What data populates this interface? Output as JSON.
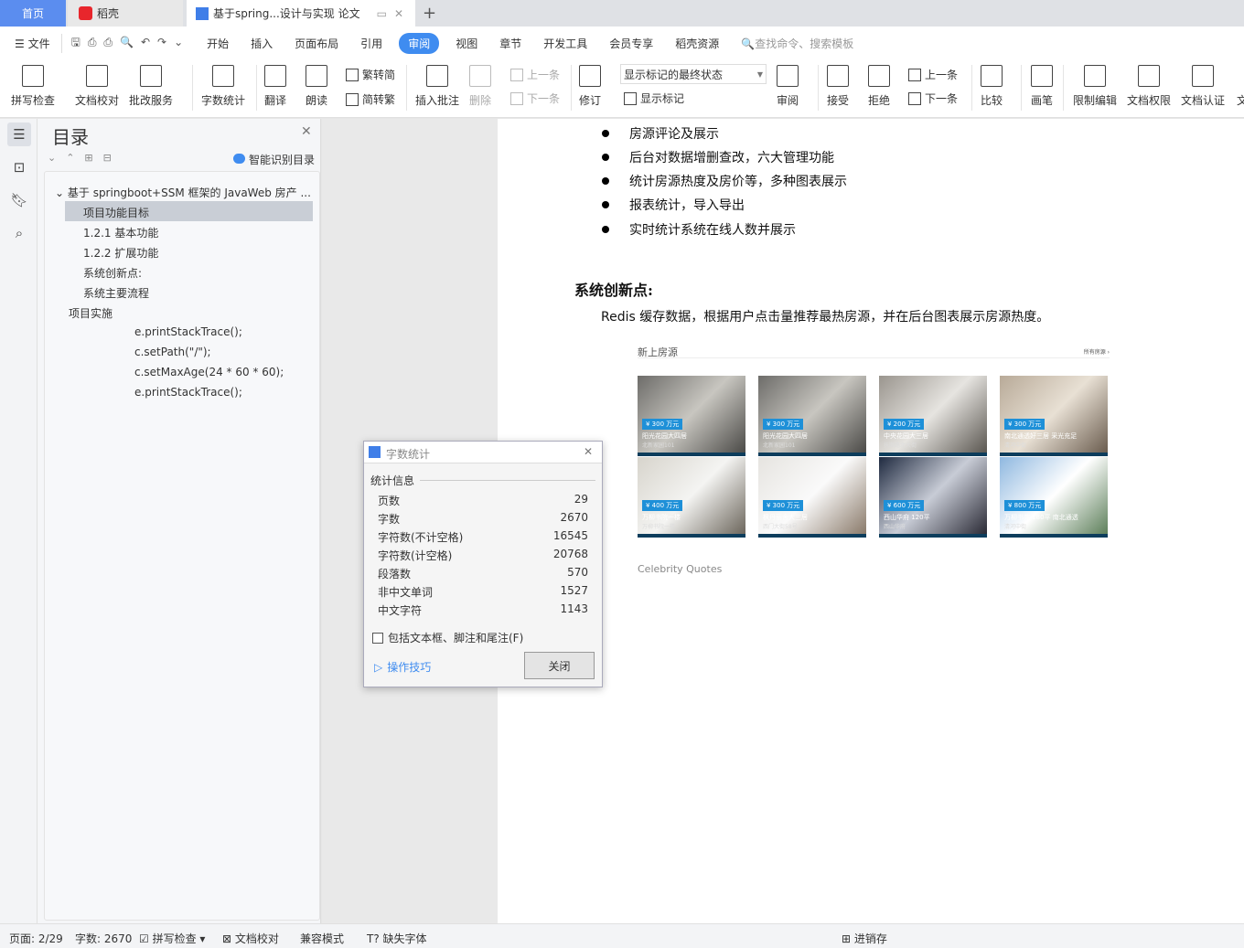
{
  "tabs": [
    {
      "label": "首页"
    },
    {
      "label": "稻壳"
    },
    {
      "label": "基于spring...设计与实现 论文"
    }
  ],
  "menu": {
    "file": "文件",
    "items": [
      "开始",
      "插入",
      "页面布局",
      "引用",
      "审阅",
      "视图",
      "章节",
      "开发工具",
      "会员专享",
      "稻壳资源"
    ],
    "active": "审阅",
    "search_placeholder": "查找命令、搜索模板"
  },
  "ribbon": {
    "spell": "拼写检查",
    "proof": "文档校对",
    "review_service": "批改服务",
    "wordcount": "字数统计",
    "translate": "翻译",
    "read": "朗读",
    "t2s": "繁转简",
    "s2t": "简转繁",
    "insert_comment": "插入批注",
    "delete": "删除",
    "prev": "上一条",
    "next": "下一条",
    "revise": "修订",
    "markup_state": "显示标记的最终状态",
    "show_markup": "显示标记",
    "review": "审阅",
    "accept": "接受",
    "reject": "拒绝",
    "prev2": "上一条",
    "next2": "下一条",
    "compare": "比较",
    "pen": "画笔",
    "restrict": "限制编辑",
    "perm": "文档权限",
    "cert": "文档认证",
    "more": "文"
  },
  "toc": {
    "title": "目录",
    "smart": "智能识别目录",
    "items": [
      "基于 springboot+SSM 框架的 JavaWeb 房产 ...",
      "项目功能目标",
      "1.2.1  基本功能",
      "1.2.2  扩展功能",
      "系统创新点:",
      "系统主要流程",
      "项目实施",
      "e.printStackTrace();",
      "c.setPath(\"/\");",
      "c.setMaxAge(24 * 60 * 60);",
      "e.printStackTrace();"
    ]
  },
  "doc": {
    "bullets": [
      "房源评论及展示",
      "后台对数据增删查改，六大管理功能",
      "统计房源热度及房价等，多种图表展示",
      "报表统计，导入导出",
      "实时统计系统在线人数并展示"
    ],
    "heading": "系统创新点:",
    "para": "Redis 缓存数据，根据用户点击量推荐最热房源，并在后台图表展示房源热度。",
    "figure": {
      "title": "新上房源",
      "more": "所有房源 ›",
      "caption": "Celebrity Quotes",
      "cards": [
        {
          "price": "¥ 300 万元",
          "name": "阳光花园大四居",
          "addr": "北新家园101"
        },
        {
          "price": "¥ 300 万元",
          "name": "阳光花园大四居",
          "addr": "北新家园101"
        },
        {
          "price": "¥ 200 万元",
          "name": "中央花园大三居",
          "addr": "抚顺路北大街"
        },
        {
          "price": "¥ 300 万元",
          "name": "南北通透好三居 采光充足",
          "addr": "清河中街"
        },
        {
          "price": "¥ 400 万元",
          "name": "万柳书院一楼",
          "addr": "万柳书院一楼"
        },
        {
          "price": "¥ 300 万元",
          "name": "枫丹丽舍大三居",
          "addr": "西门大街58号"
        },
        {
          "price": "¥ 600 万元",
          "name": "西山华府 120平",
          "addr": "西山华府"
        },
        {
          "price": "¥ 800 万元",
          "name": "万柳书苑 180平 南北通透",
          "addr": "清河中街"
        }
      ]
    }
  },
  "dialog": {
    "title": "字数统计",
    "section": "统计信息",
    "rows": [
      {
        "k": "页数",
        "v": "29"
      },
      {
        "k": "字数",
        "v": "2670"
      },
      {
        "k": "字符数(不计空格)",
        "v": "16545"
      },
      {
        "k": "字符数(计空格)",
        "v": "20768"
      },
      {
        "k": "段落数",
        "v": "570"
      },
      {
        "k": "非中文单词",
        "v": "1527"
      },
      {
        "k": "中文字符",
        "v": "1143"
      }
    ],
    "checkbox": "包括文本框、脚注和尾注(F)",
    "tips": "操作技巧",
    "close": "关闭"
  },
  "status": {
    "page": "页面: 2/29",
    "words": "字数: 2670",
    "spell": "拼写检查",
    "proof": "文档校对",
    "compat": "兼容模式",
    "font": "缺失字体",
    "save": "进销存"
  },
  "colors": {
    "accent": "#3f8cf0",
    "card_bar": "#0d3d5c",
    "price_badge": "#1e90d8"
  }
}
